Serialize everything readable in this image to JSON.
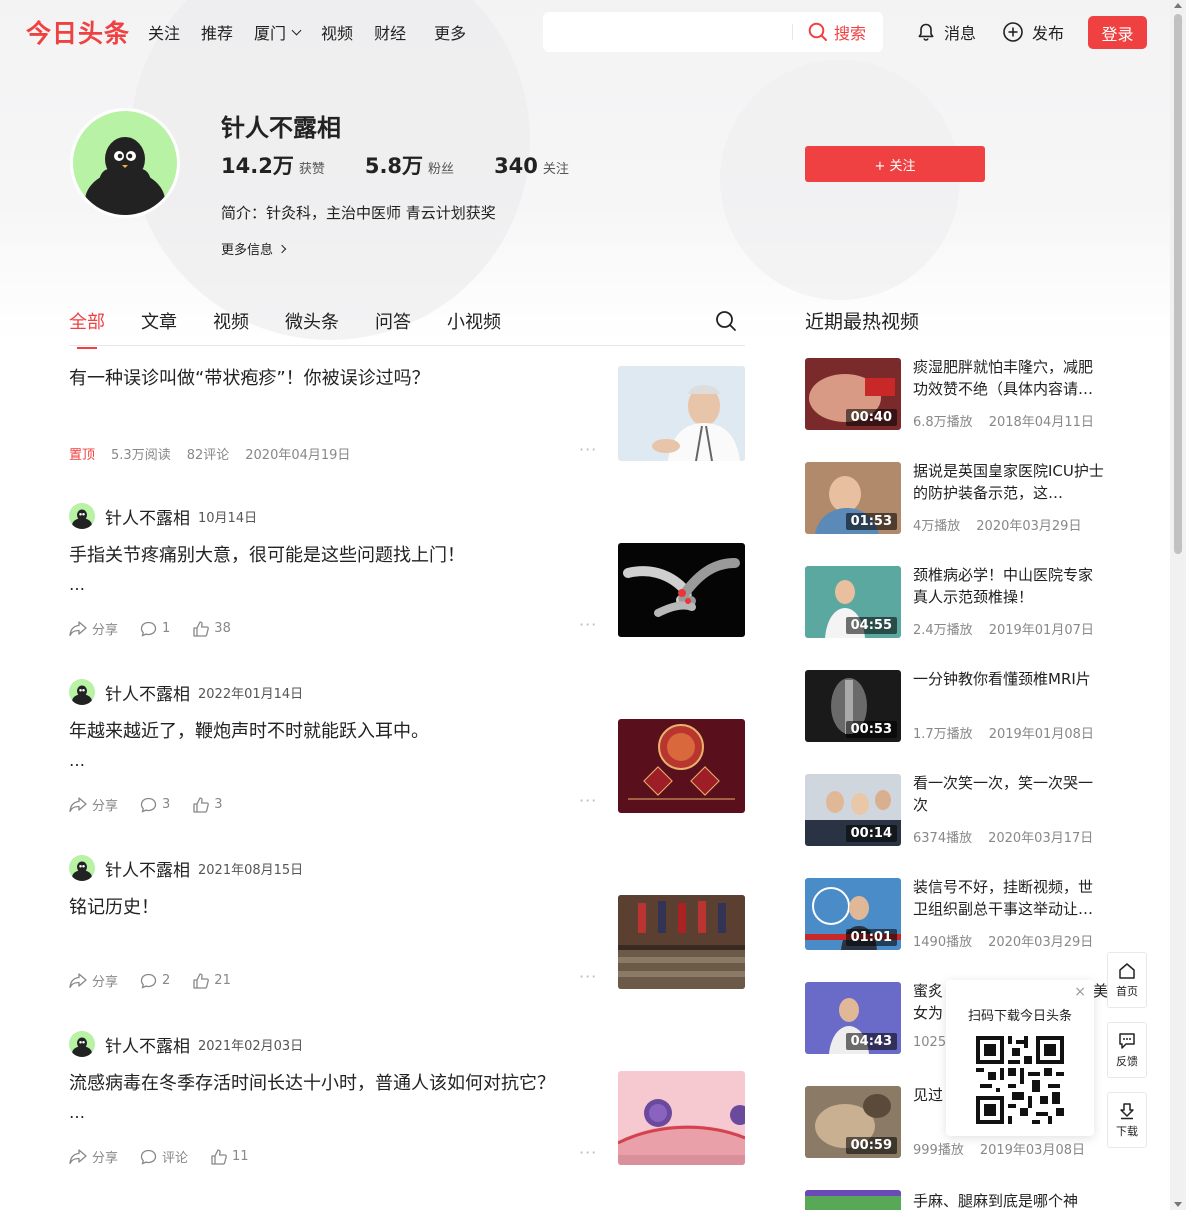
{
  "header": {
    "logo": "今日头条",
    "nav": [
      "关注",
      "推荐",
      "厦门",
      "视频",
      "财经",
      "更多"
    ],
    "search_placeholder": "",
    "search_label": "搜索",
    "messages_label": "消息",
    "publish_label": "发布",
    "login_label": "登录"
  },
  "profile": {
    "name": "针人不露相",
    "likes_num": "14.2万",
    "likes_label": "获赞",
    "fans_num": "5.8万",
    "fans_label": "粉丝",
    "following_num": "340",
    "following_label": "关注",
    "bio": "简介：针灸科，主治中医师 青云计划获奖",
    "more_info": "更多信息",
    "follow_button": "+ 关注"
  },
  "tabs": [
    "全部",
    "文章",
    "视频",
    "微头条",
    "问答",
    "小视频"
  ],
  "feed": [
    {
      "title": "有一种误诊叫做“带状疱疹”！你被误诊过吗？",
      "pinned": "置顶",
      "reads": "5.3万阅读",
      "comments": "82评论",
      "date": "2020年04月19日"
    },
    {
      "author": "针人不露相",
      "date": "10月14日",
      "text": "手指关节疼痛别大意，很可能是这些问题找上门！",
      "ellipsis": "…",
      "share": "分享",
      "comments": "1",
      "likes": "38"
    },
    {
      "author": "针人不露相",
      "date": "2022年01月14日",
      "text": "年越来越近了，鞭炮声时不时就能跃入耳中。",
      "ellipsis": "…",
      "share": "分享",
      "comments": "3",
      "likes": "3"
    },
    {
      "author": "针人不露相",
      "date": "2021年08月15日",
      "text": "铭记历史！",
      "ellipsis": "",
      "share": "分享",
      "comments": "2",
      "likes": "21"
    },
    {
      "author": "针人不露相",
      "date": "2021年02月03日",
      "text": "流感病毒在冬季存活时间长达十小时，普通人该如何对抗它？",
      "ellipsis": "…",
      "share": "分享",
      "comments": "评论",
      "likes": "11"
    }
  ],
  "right": {
    "title": "近期最热视频",
    "videos": [
      {
        "title": "痰湿肥胖就怕丰隆穴，减肥功效赞不绝（具体内容请…",
        "duration": "00:40",
        "plays": "6.8万播放",
        "date": "2018年04月11日"
      },
      {
        "title": "据说是英国皇家医院ICU护士的防护装备示范，这…",
        "duration": "01:53",
        "plays": "4万播放",
        "date": "2020年03月29日"
      },
      {
        "title": "颈椎病必学！中山医院专家真人示范颈椎操！",
        "duration": "04:55",
        "plays": "2.4万播放",
        "date": "2019年01月07日"
      },
      {
        "title": "一分钟教你看懂颈椎MRI片",
        "duration": "00:53",
        "plays": "1.7万播放",
        "date": "2019年01月08日"
      },
      {
        "title": "看一次笑一次，笑一次哭一次",
        "duration": "00:14",
        "plays": "6374播放",
        "date": "2020年03月17日"
      },
      {
        "title": "装信号不好，挂断视频，世卫组织副总干事这举动让…",
        "duration": "01:01",
        "plays": "1490播放",
        "date": "2020年03月29日"
      },
      {
        "title": "蜜炙",
        "title2": "美",
        "title_line2": "女为",
        "duration": "04:43",
        "plays": "1025",
        "date": ""
      },
      {
        "title": "见过",
        "duration": "00:59",
        "plays": "999播放",
        "date": "2019年03月08日"
      },
      {
        "title": "手麻、腿麻到底是哪个神",
        "duration": "",
        "plays": "",
        "date": ""
      }
    ]
  },
  "float": {
    "home": "首页",
    "feedback": "反馈",
    "download": "下载",
    "qr_text": "扫码下载今日头条",
    "qr_close": "×"
  },
  "colors": {
    "accent": "#f04142",
    "avatar_bg": "#b7f2a5"
  }
}
